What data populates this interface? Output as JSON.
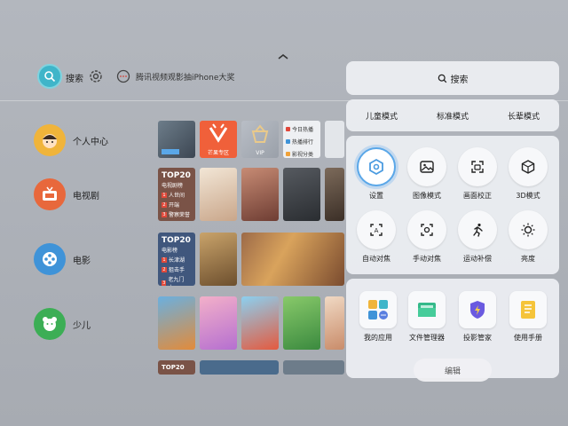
{
  "header": {
    "search_label": "搜索",
    "promo_text": "腾讯视频观影抽iPhone大奖"
  },
  "nav": [
    {
      "label": "个人中心"
    },
    {
      "label": "电视剧"
    },
    {
      "label": "电影"
    },
    {
      "label": "少儿"
    }
  ],
  "tiles": {
    "mango_label": "芒果专区",
    "vip_label": "VIP",
    "list_items": [
      "今日热播",
      "热播排行",
      "影视分类"
    ],
    "top20_tv": {
      "title": "TOP20",
      "subtitle": "电视剧榜",
      "rows": [
        "人世间",
        "开端",
        "警察荣誉"
      ]
    },
    "top20_movie": {
      "title": "TOP20",
      "subtitle": "电影榜",
      "rows": [
        "长津湖",
        "狙击手",
        "老九门之..."
      ]
    }
  },
  "panel": {
    "search_label": "搜索",
    "modes": [
      "儿童模式",
      "标准模式",
      "长辈模式"
    ],
    "quick": [
      {
        "label": "设置",
        "icon": "hexagon-settings-icon",
        "active": true
      },
      {
        "label": "图像模式",
        "icon": "image-icon"
      },
      {
        "label": "画面校正",
        "icon": "screen-correct-icon"
      },
      {
        "label": "3D模式",
        "icon": "cube-icon"
      },
      {
        "label": "自动对焦",
        "icon": "auto-focus-icon"
      },
      {
        "label": "手动对焦",
        "icon": "manual-focus-icon"
      },
      {
        "label": "运动补偿",
        "icon": "running-icon"
      },
      {
        "label": "亮度",
        "icon": "sun-icon"
      }
    ],
    "apps": [
      {
        "label": "我的应用",
        "icon": "apps-grid-icon"
      },
      {
        "label": "文件管理器",
        "icon": "folder-icon"
      },
      {
        "label": "投影管家",
        "icon": "shield-icon"
      },
      {
        "label": "使用手册",
        "icon": "manual-icon"
      }
    ],
    "bottom_pill": "编辑"
  },
  "colors": {
    "accent_blue": "#5aa7e8",
    "search_teal": "#3fb5c9",
    "mango_orange": "#f0603a"
  }
}
